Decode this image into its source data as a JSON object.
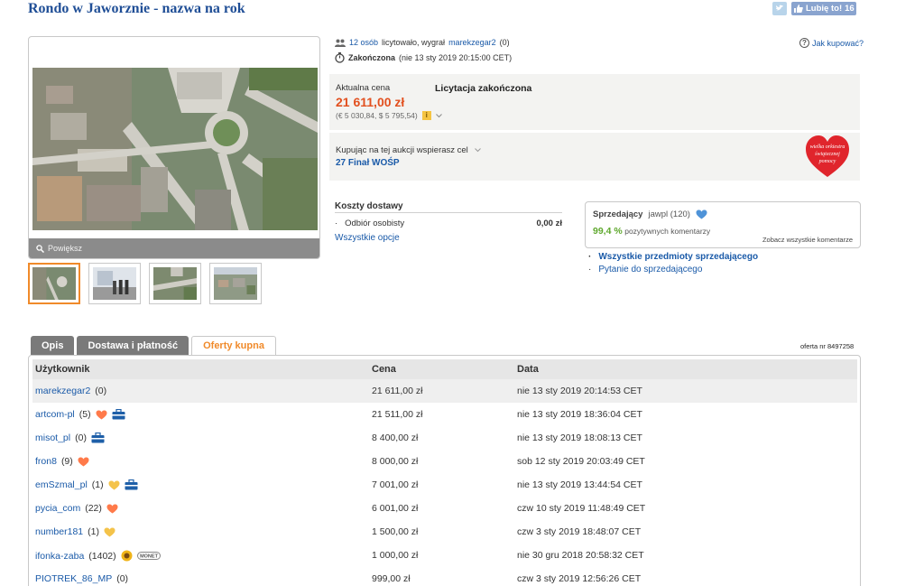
{
  "header": {
    "title": "Rondo w Jaworznie - nazwa na rok",
    "like_label": "Lubię to!",
    "like_count": "16"
  },
  "gallery": {
    "zoom_label": "Powiększ",
    "thumbs": [
      "thumb-1",
      "thumb-2",
      "thumb-3",
      "thumb-4"
    ]
  },
  "auction": {
    "bidders_link": "12 osób",
    "bidders_text": "licytowało, wygrał",
    "winner": "marekzegar2",
    "winner_score": "(0)",
    "ended_label": "Zakończona",
    "ended_date": "(nie 13 sty 2019 20:15:00 CET)",
    "how_to_buy": "Jak kupować?"
  },
  "price": {
    "label": "Aktualna cena",
    "value": "21 611,00 zł",
    "foreign": "(€ 5 030,84, $ 5 795,54)",
    "status": "Licytacja zakończona"
  },
  "charity": {
    "text": "Kupując na tej aukcji wspierasz cel",
    "link": "27 Finał WOŚP",
    "logo_text": [
      "wielka orkiestra",
      "świątecznej",
      "pomocy"
    ]
  },
  "shipping": {
    "title": "Koszty dostawy",
    "option": "Odbiór osobisty",
    "option_price": "0,00 zł",
    "all_options": "Wszystkie opcje"
  },
  "seller": {
    "label": "Sprzedający",
    "name": "jawpl",
    "score": "(120)",
    "positive_pct": "99,4 %",
    "positive_text": "pozytywnych komentarzy",
    "see_comments": "Zobacz wszystkie komentarze",
    "link_all_items": "Wszystkie przedmioty sprzedającego",
    "link_question": "Pytanie do sprzedającego"
  },
  "tabs": {
    "description": "Opis",
    "delivery": "Dostawa i płatność",
    "offers": "Oferty kupna",
    "offer_no": "oferta nr 8497258"
  },
  "offers_table": {
    "headers": {
      "user": "Użytkownik",
      "price": "Cena",
      "date": "Data"
    },
    "rows": [
      {
        "user": "marekzegar2",
        "score": "(0)",
        "price": "21 611,00 zł",
        "date": "nie 13 sty 2019 20:14:53 CET"
      },
      {
        "user": "artcom-pl",
        "score": "(5)",
        "price": "21 511,00 zł",
        "date": "nie 13 sty 2019 18:36:04 CET"
      },
      {
        "user": "misot_pl",
        "score": "(0)",
        "price": "8 400,00 zł",
        "date": "nie 13 sty 2019 18:08:13 CET"
      },
      {
        "user": "fron8",
        "score": "(9)",
        "price": "8 000,00 zł",
        "date": "sob 12 sty 2019 20:03:49 CET"
      },
      {
        "user": "emSzmal_pl",
        "score": "(1)",
        "price": "7 001,00 zł",
        "date": "nie 13 sty 2019 13:44:54 CET"
      },
      {
        "user": "pycia_com",
        "score": "(22)",
        "price": "6 001,00 zł",
        "date": "czw 10 sty 2019 11:48:49 CET"
      },
      {
        "user": "number181",
        "score": "(1)",
        "price": "1 500,00 zł",
        "date": "czw 3 sty 2019 18:48:07 CET"
      },
      {
        "user": "ifonka-zaba",
        "score": "(1402)",
        "price": "1 000,00 zł",
        "date": "nie 30 gru 2018 20:58:32 CET"
      },
      {
        "user": "PIOTREK_86_MP",
        "score": "(0)",
        "price": "999,00 zł",
        "date": "czw 3 sty 2019 12:56:26 CET"
      }
    ]
  },
  "badge_labels": {
    "monety": "MONET"
  },
  "colors": {
    "title": "#1f4e96",
    "link": "#1a5aa8",
    "price": "#e2501f",
    "positive": "#5fa82e",
    "active_tab": "#f08a2a",
    "heart_red": "#e0252c"
  }
}
